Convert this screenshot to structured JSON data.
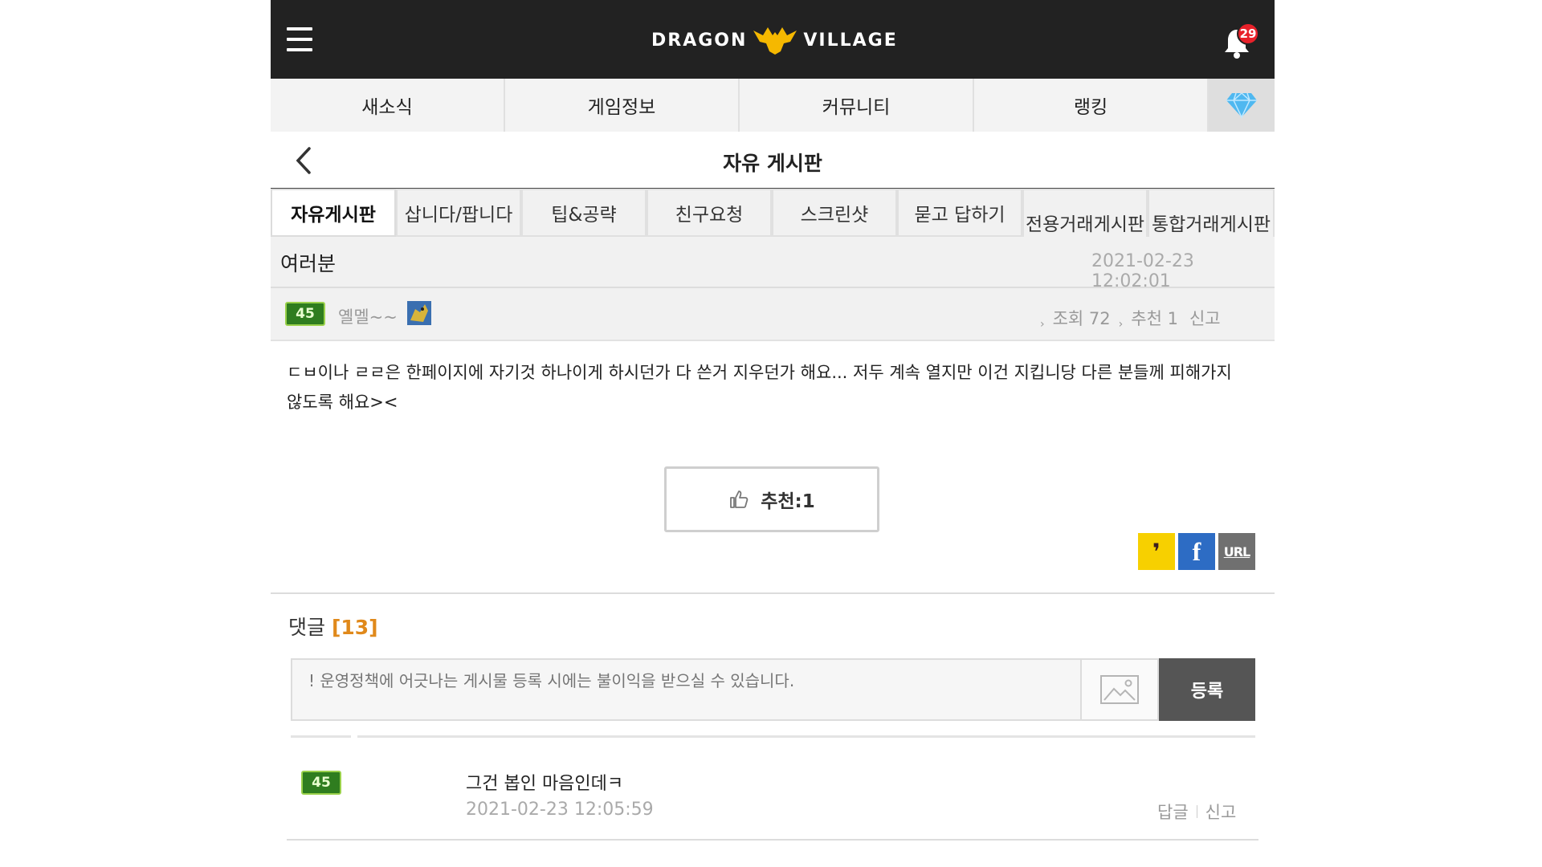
{
  "header": {
    "logo_left": "DRAGON",
    "logo_right": "VILLAGE",
    "notification_count": "29",
    "colors": {
      "bar": "#222222",
      "badge": "#e8212a",
      "logo_emblem": "#f5b800"
    }
  },
  "main_nav": {
    "items": [
      {
        "label": "새소식"
      },
      {
        "label": "게임정보"
      },
      {
        "label": "커뮤니티"
      },
      {
        "label": "랭킹"
      }
    ],
    "gem_icon": "diamond-icon"
  },
  "board": {
    "title": "자유 게시판",
    "tabs": [
      {
        "label": "자유게시판",
        "active": true
      },
      {
        "label": "삽니다/팝니다"
      },
      {
        "label": "팁&공략"
      },
      {
        "label": "친구요청"
      },
      {
        "label": "스크린샷"
      },
      {
        "label": "묻고 답하기"
      },
      {
        "label": "전용거래게시판"
      },
      {
        "label": "통합거래게시판"
      }
    ]
  },
  "post": {
    "title": "여러분",
    "date": "2021-02-23 12:02:01",
    "author_level": "45",
    "author": "옐멜~~",
    "views": "조회 72",
    "recommend_count_label": "추천 1",
    "report_label": "신고",
    "body": "ㄷㅂ이나 ㄹㄹ은 한페이지에 자기것 하나이게 하시던가 다 쓴거 지우던가 해요... 저두 계속 열지만 이건 지킵니당 다른 분들께 피해가지 않도록 해요><",
    "recommend_button": "추천:1",
    "share": {
      "kakao_glyph": "❜",
      "facebook_glyph": "f",
      "url_label": "URL"
    }
  },
  "comments": {
    "label": "댓글",
    "count": "[13]",
    "input_placeholder": "! 운영정책에 어긋나는 게시물 등록 시에는 불이익을 받으실 수 있습니다.",
    "submit_label": "등록",
    "items": [
      {
        "level": "45",
        "text": "그건 봅인 마음인데ㅋ",
        "date": "2021-02-23 12:05:59",
        "reply_label": "답글",
        "report_label": "신고"
      }
    ]
  }
}
